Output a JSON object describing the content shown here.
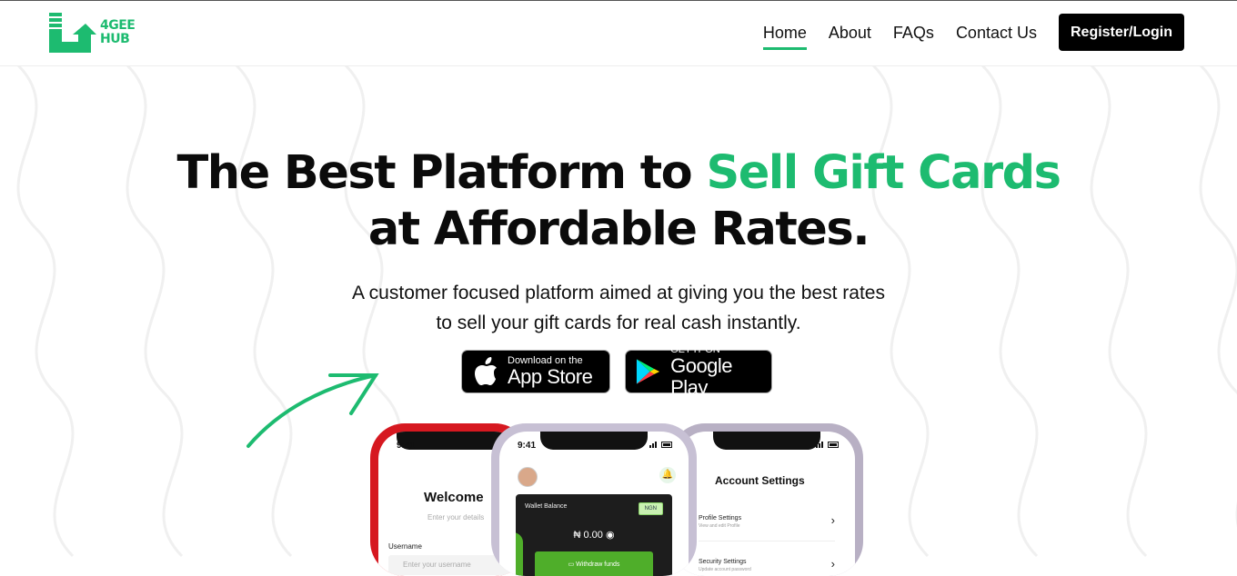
{
  "brand": {
    "name_line1": "4GEE",
    "name_line2": "HUB",
    "accent_color": "#1dbb70"
  },
  "nav": {
    "items": [
      {
        "label": "Home",
        "active": true
      },
      {
        "label": "About",
        "active": false
      },
      {
        "label": "FAQs",
        "active": false
      },
      {
        "label": "Contact Us",
        "active": false
      }
    ],
    "cta_label": "Register/Login"
  },
  "hero": {
    "title_part1": "The Best Platform to ",
    "title_highlight": "Sell Gift Cards",
    "title_line2": "at Affordable Rates.",
    "subtitle_line1": "A customer focused platform aimed at giving you the best rates",
    "subtitle_line2": "to sell your gift cards for real cash instantly."
  },
  "stores": {
    "apple": {
      "small": "Download on the",
      "big": "App Store",
      "icon": "apple-icon"
    },
    "google": {
      "small": "GET IT ON",
      "big": "Google Play",
      "icon": "google-play-icon"
    }
  },
  "phones": {
    "login": {
      "time": "9:41",
      "welcome": "Welcome",
      "welcome_sub": "Enter your details",
      "username_label": "Username",
      "username_placeholder": "Enter your username"
    },
    "wallet": {
      "time": "9:41",
      "balance_label": "Wallet Balance",
      "currency": "NGN",
      "balance": "₦ 0.00",
      "withdraw_label": "Withdraw funds"
    },
    "account": {
      "title": "Account Settings",
      "items": [
        {
          "title": "Profile Settings",
          "sub": "View and edit Profile"
        },
        {
          "title": "Security Settings",
          "sub": "Update account password"
        }
      ]
    }
  }
}
